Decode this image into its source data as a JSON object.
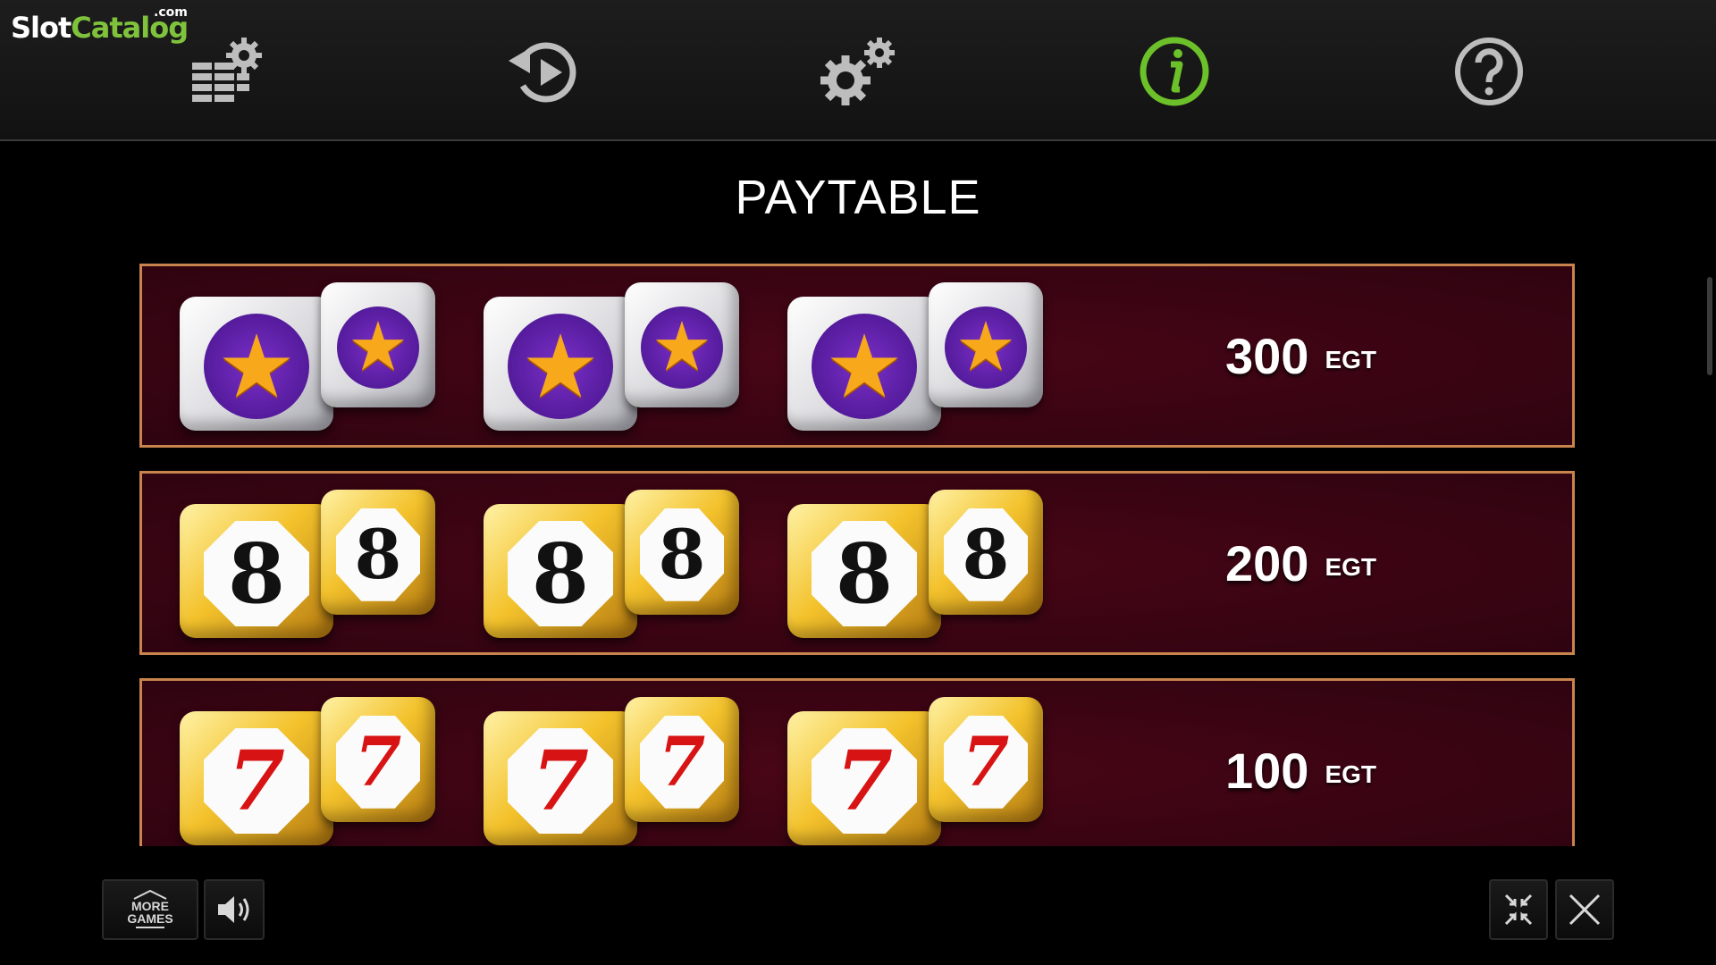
{
  "watermark": {
    "part1": "Slot",
    "part2": "Catalog",
    "suffix": ".com"
  },
  "top_nav": [
    {
      "name": "bet-settings",
      "icon": "stack-gear-icon",
      "active": false
    },
    {
      "name": "autoplay",
      "icon": "replay-icon",
      "active": false
    },
    {
      "name": "settings",
      "icon": "gears-icon",
      "active": false
    },
    {
      "name": "info",
      "icon": "info-icon",
      "active": true
    },
    {
      "name": "help",
      "icon": "question-icon",
      "active": false
    }
  ],
  "colors": {
    "active_icon": "#6cc12a",
    "inactive_icon": "#bdbdbd",
    "row_border": "#c9834d",
    "row_bg": "#3a0413"
  },
  "title": "PAYTABLE",
  "paytable": [
    {
      "symbol": "star",
      "glyph": "★",
      "count": 3,
      "amount": "300",
      "currency": "EGT"
    },
    {
      "symbol": "eight",
      "glyph": "8",
      "count": 3,
      "amount": "200",
      "currency": "EGT"
    },
    {
      "symbol": "seven",
      "glyph": "7",
      "count": 3,
      "amount": "100",
      "currency": "EGT"
    }
  ],
  "bottom_bar": {
    "more_games": {
      "line1": "MORE",
      "line2": "GAMES",
      "icon": "home-icon"
    },
    "sound_icon": "speaker-icon",
    "exit_fullscreen_icon": "minimize-icon",
    "close_icon": "close-icon"
  }
}
